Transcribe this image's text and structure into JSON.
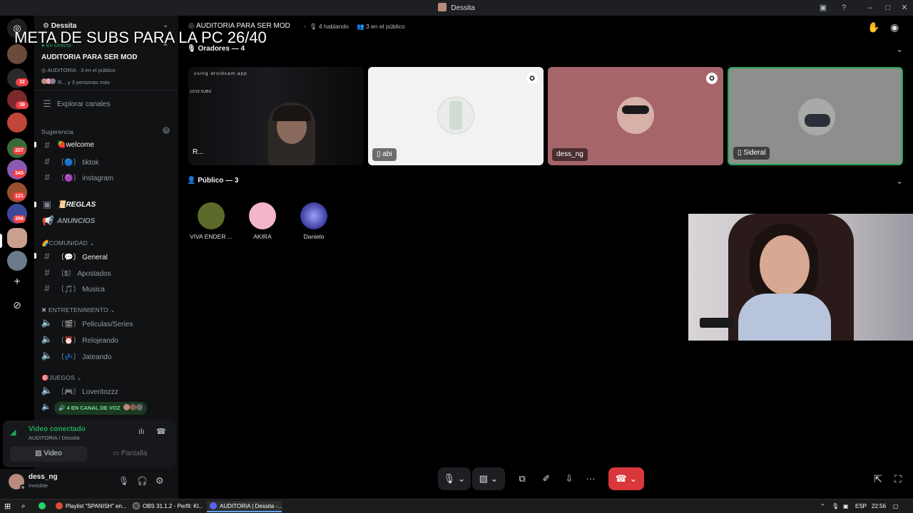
{
  "window": {
    "title": "Dessita"
  },
  "overlay": {
    "text": "META DE SUBS PARA LA PC 26/40"
  },
  "colors": {
    "accent": "#5865f2",
    "green": "#23a55a",
    "red": "#da373c",
    "badge": "#f23f43"
  },
  "rail": {
    "badges": [
      "32",
      "38",
      "207",
      "345",
      "121",
      "356"
    ]
  },
  "sidebar": {
    "server_name": "Dessita",
    "live_tag": "En Directo",
    "stage_title": "AUDITORIA PARA SER MOD",
    "stage_meta": "AUDITORIA · 3 en el público",
    "stage_people": "R... y 3 personas más",
    "explore": "Explorar canales",
    "suggestion_label": "Sugerencia",
    "channels_top": [
      {
        "icon": "#",
        "label": "🍓welcome",
        "active": true
      },
      {
        "icon": "#",
        "label": "〔🔵〕 tiktok"
      },
      {
        "icon": "#",
        "label": "〔🟣〕 instagram"
      }
    ],
    "reglas": "📜REGLAS",
    "anuncios": "ANUNCIOS",
    "cat_comunidad": "🌈COMUNIDAD ⌄",
    "channels_comunidad": [
      {
        "icon": "#",
        "label": "〔💬〕 General",
        "active": true
      },
      {
        "icon": "#",
        "label": "〔$〕 Apostados"
      },
      {
        "icon": "#",
        "label": "〔🎵〕 Musica"
      }
    ],
    "cat_entretenimiento": "✖ ENTRETENIMIENTO ⌄",
    "channels_entretenimiento": [
      {
        "label": "〔🎬〕 Peliculas/Series"
      },
      {
        "label": "〔⏰〕 Relojeando"
      },
      {
        "label": "〔💤〕 Jateando"
      }
    ],
    "cat_juegos": "🎯JUEGOS ⌄",
    "channels_juegos": [
      {
        "label": "〔🎮〕 Loveritozzz"
      }
    ],
    "voice_pill": "4 EN CANAL DE VOZ"
  },
  "voice": {
    "status": "Video conectado",
    "location": "AUDITORIA / Dessita",
    "video_label": "Video",
    "screen_label": "Pantalla"
  },
  "user": {
    "name": "dess_ng",
    "status": "Invisible"
  },
  "main": {
    "stage_title": "AUDITORIA PARA SER MOD",
    "speaking": "4 hablando",
    "audience_count": "3 en el público",
    "speakers_header": "Oradores — 4",
    "audience_header": "Público — 3",
    "speakers": [
      {
        "name": "R...",
        "watermark": "using droidcam.app",
        "subs": "12/15 SUBS"
      },
      {
        "name": "abi"
      },
      {
        "name": "dess_ng"
      },
      {
        "name": "Sideral"
      }
    ],
    "audience": [
      {
        "name": "VIVA ENDER ..."
      },
      {
        "name": "AKIRA"
      },
      {
        "name": "Danielo"
      }
    ]
  },
  "taskbar": {
    "items": [
      {
        "label": "Playlist \"SPANISH\" en..."
      },
      {
        "label": "OBS 31.1.2 - Perfil: Kl..."
      },
      {
        "label": "AUDITORIA | Dessita -..."
      }
    ],
    "lang": "ESP",
    "time": "22:56"
  }
}
